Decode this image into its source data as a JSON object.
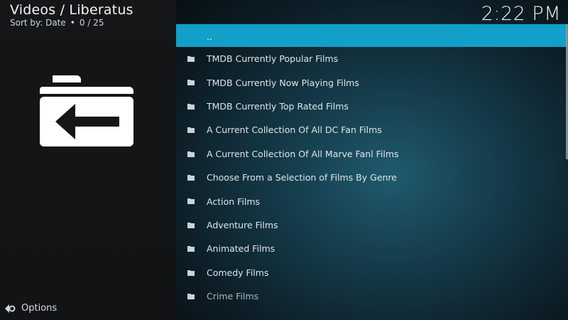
{
  "header": {
    "title": "Videos / Liberatus",
    "sort_label": "Sort by: Date",
    "separator": "•",
    "count": "0 / 25"
  },
  "clock": "2:22 PM",
  "sidebar": {
    "options_label": "Options"
  },
  "list": {
    "items": [
      {
        "label": ".."
      },
      {
        "label": "TMDB Currently Popular Films"
      },
      {
        "label": "TMDB Currently Now Playing Films"
      },
      {
        "label": "TMDB Currently Top Rated Films"
      },
      {
        "label": "A Current Collection Of All DC Fan Films"
      },
      {
        "label": "A Current Collection Of All Marve Fanl Films"
      },
      {
        "label": "Choose From a Selection of Films By Genre"
      },
      {
        "label": "Action Films"
      },
      {
        "label": "Adventure Films"
      },
      {
        "label": "Animated Films"
      },
      {
        "label": "Comedy Films"
      },
      {
        "label": "Crime Films"
      }
    ]
  },
  "colors": {
    "accent": "#12a0c8",
    "sidebar_bg": "#131516",
    "panel_bg": "#153c4b"
  },
  "icons": {
    "back_folder": "folder-back-icon",
    "list_folder": "folder-icon",
    "options": "options-icon"
  }
}
